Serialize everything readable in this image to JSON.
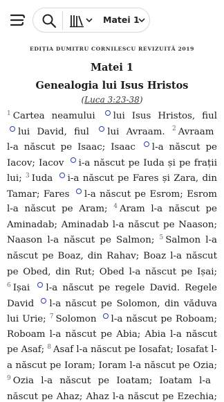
{
  "header": {
    "reference": "Matei 1",
    "icons": [
      "menu-icon",
      "search-icon",
      "library-icon",
      "chevron-down-icon"
    ]
  },
  "edition": "EDIȚIA DUMITRU CORNILESCU REVIZUITĂ 2019",
  "chapter_title": "Matei 1",
  "section_heading": "Genealogia lui Isus Hristos",
  "cross_reference": "Luca 3:23-38",
  "colors": {
    "note_marker": "#2b3bb5",
    "verse_number": "#666666"
  },
  "lines": [
    [
      {
        "v": "1"
      },
      {
        "t": "Cartea neamului"
      },
      {
        "n": 1
      },
      {
        "t": "lui Isus Hristos, fiul"
      }
    ],
    [
      {
        "n": 1
      },
      {
        "t": "lui David, fiul"
      },
      {
        "n": 1
      },
      {
        "t": "lui Avraam."
      },
      {
        "v": "2"
      },
      {
        "t": "Avraam"
      }
    ],
    [
      {
        "t": "l-a născut pe Isaac; Isaac"
      },
      {
        "n": 1
      },
      {
        "t": "l-a născut pe"
      }
    ],
    [
      {
        "t": "Iacov; Iacov"
      },
      {
        "n": 1
      },
      {
        "t": "i-a născut pe Iuda și pe frații"
      }
    ],
    [
      {
        "t": "lui;"
      },
      {
        "v": "3"
      },
      {
        "t": "Iuda"
      },
      {
        "n": 1
      },
      {
        "t": "i-a născut pe Fares și Zara, din"
      }
    ],
    [
      {
        "t": "Tamar; Fares"
      },
      {
        "n": 1
      },
      {
        "t": "l-a născut pe Esrom; Esrom"
      }
    ],
    [
      {
        "t": "l-a născut pe Aram;"
      },
      {
        "v": "4"
      },
      {
        "t": "Aram l-a născut pe"
      }
    ],
    [
      {
        "t": "Aminadab; Aminadab l-a născut pe Naason;"
      }
    ],
    [
      {
        "t": "Naason l-a născut pe Salmon;"
      },
      {
        "v": "5"
      },
      {
        "t": "Salmon l-a"
      }
    ],
    [
      {
        "t": "născut pe Boaz, din Rahav; Boaz l-a născut"
      }
    ],
    [
      {
        "t": "pe Obed, din Rut; Obed l-a născut pe Ișai;"
      }
    ],
    [
      {
        "v": "6"
      },
      {
        "t": "Ișai"
      },
      {
        "n": 1
      },
      {
        "t": "l-a născut pe regele David. Regele"
      }
    ],
    [
      {
        "t": "David"
      },
      {
        "n": 1
      },
      {
        "t": "l-a născut pe Solomon, din văduva"
      }
    ],
    [
      {
        "t": "lui Urie;"
      },
      {
        "v": "7"
      },
      {
        "t": "Solomon"
      },
      {
        "n": 1
      },
      {
        "t": "l-a născut pe Roboam;"
      }
    ],
    [
      {
        "t": "Roboam l-a născut pe Abia; Abia l-a născut"
      }
    ],
    [
      {
        "t": "pe Asaf;"
      },
      {
        "v": "8"
      },
      {
        "t": "Asaf l-a născut pe Iosafat; Iosafat l-"
      }
    ],
    [
      {
        "t": "a născut pe Ioram; Ioram l-a născut pe Ozia;"
      }
    ],
    [
      {
        "v": "9"
      },
      {
        "t": "Ozia l-a născut pe Ioatam; Ioatam l-a"
      }
    ],
    [
      {
        "t": "născut pe Ahaz; Ahaz l-a născut pe Ezechia;"
      }
    ]
  ]
}
